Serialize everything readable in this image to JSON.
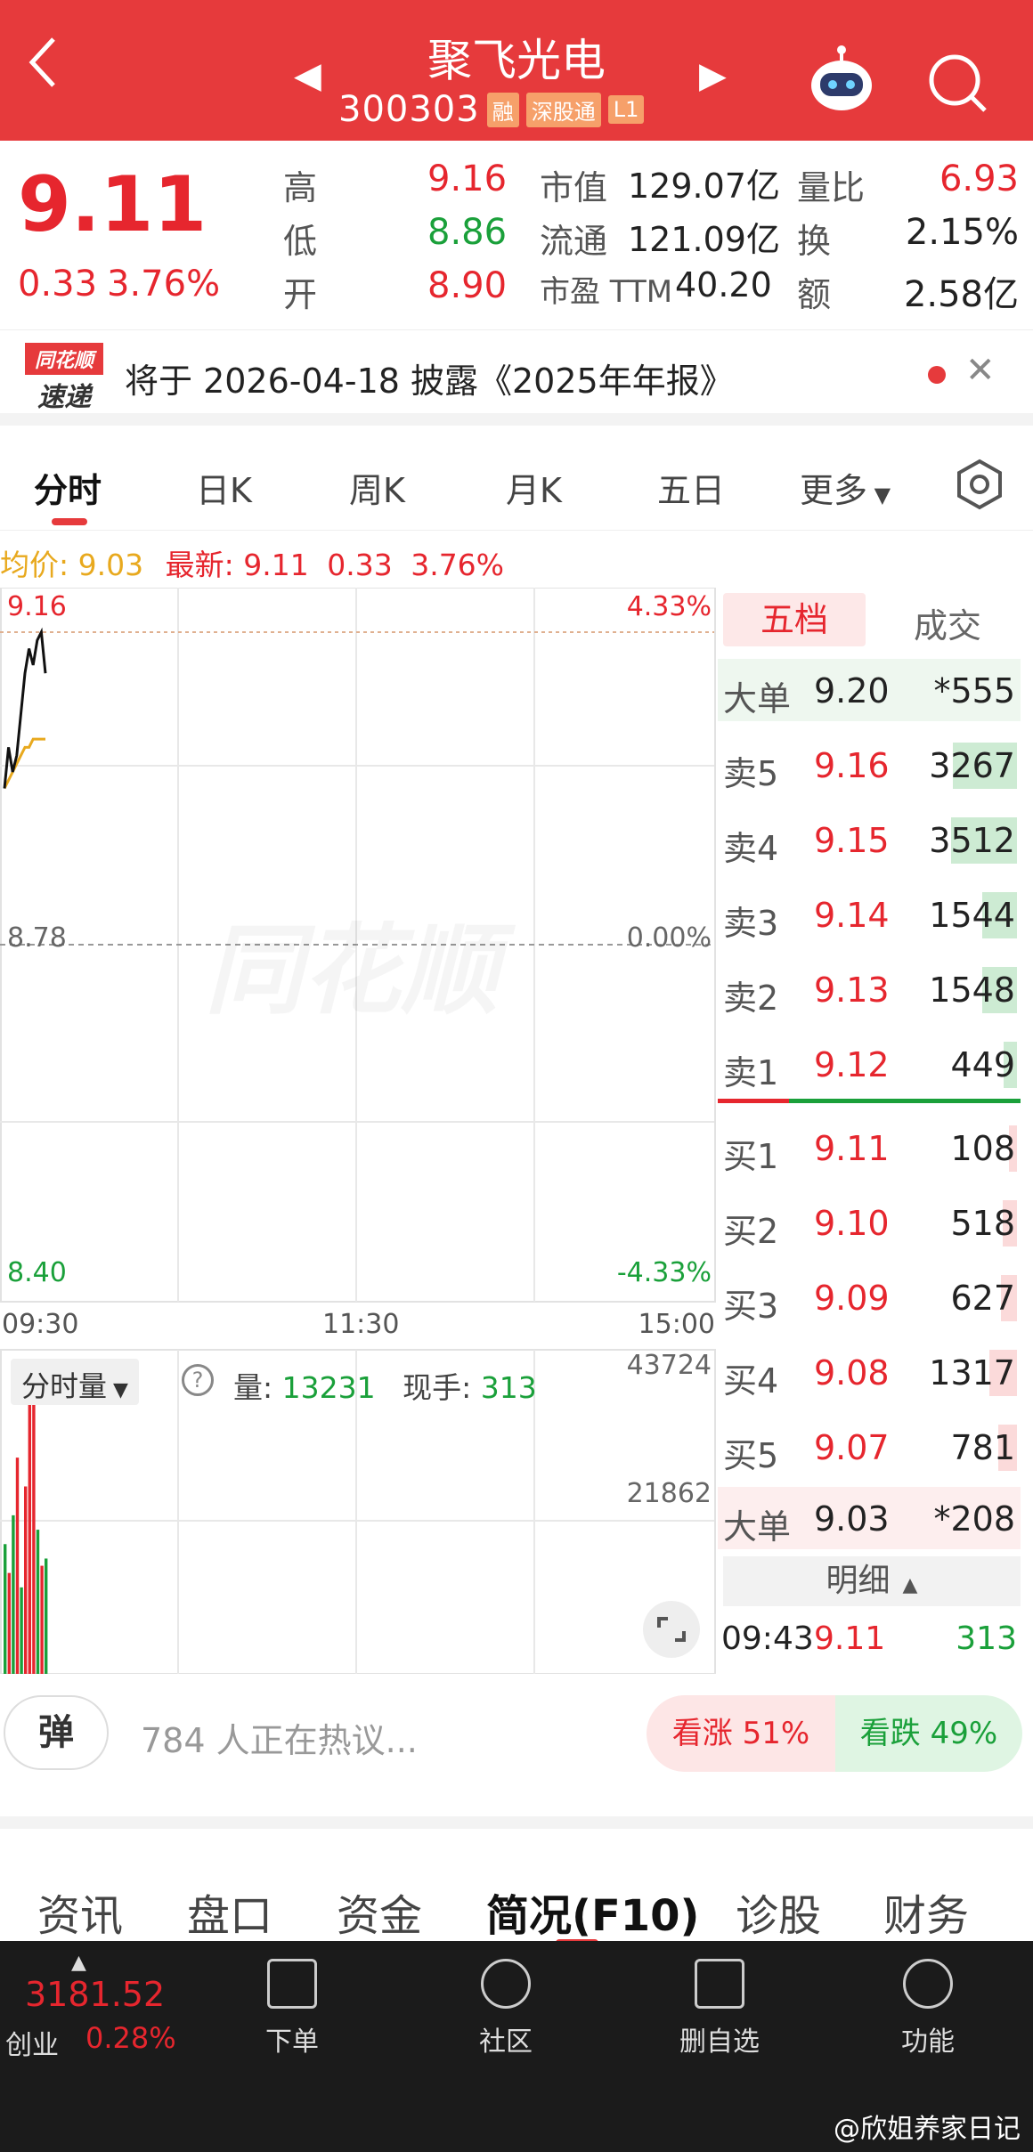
{
  "header": {
    "title": "聚飞光电",
    "code": "300303",
    "tags": [
      "融",
      "深股通",
      "L1"
    ]
  },
  "quote": {
    "price": "9.11",
    "change": "0.33",
    "change_pct": "3.76%",
    "labels": {
      "high": "高",
      "low": "低",
      "open": "开",
      "mcap": "市值",
      "float": "流通",
      "pe": "市盈 TTM",
      "vol_ratio": "量比",
      "turnover": "换",
      "amount": "额"
    },
    "high": "9.16",
    "low": "8.86",
    "open": "8.90",
    "mcap": "129.07亿",
    "float": "121.09亿",
    "pe": "40.20",
    "vol_ratio": "6.93",
    "turnover": "2.15%",
    "amount": "2.58亿"
  },
  "notice": {
    "logo_top": "同花顺",
    "logo_bottom": "速递",
    "text": "将于 2026-04-18 披露《2025年年报》"
  },
  "chart_tabs": [
    "分时",
    "日K",
    "周K",
    "月K",
    "五日",
    "更多"
  ],
  "chart_info": {
    "avg_label": "均价:",
    "avg_value": "9.03",
    "last_label": "最新:",
    "last_value": "9.11",
    "last_change": "0.33",
    "last_pct": "3.76%"
  },
  "chart_data": {
    "type": "line",
    "title": "",
    "x_ticks": [
      "09:30",
      "11:30",
      "15:00"
    ],
    "y_left_ticks": [
      "9.16",
      "8.78",
      "8.40"
    ],
    "y_right_ticks": [
      "4.33%",
      "0.00%",
      "-4.33%"
    ],
    "ylim": [
      8.4,
      9.16
    ],
    "prev_close": 8.78,
    "series": [
      {
        "values": [
          8.97,
          9.02,
          8.99,
          9.01,
          9.06,
          9.11,
          9.14,
          9.12,
          9.15,
          9.16,
          9.11
        ]
      },
      {
        "values": [
          8.97,
          8.98,
          8.99,
          9.0,
          9.01,
          9.02,
          9.02,
          9.03,
          9.03,
          9.03,
          9.03
        ]
      }
    ],
    "colors": {
      "price": "#111111",
      "avg": "#e8a91e",
      "prev_close": "#999999"
    },
    "volume": {
      "label": "分时量",
      "vol_label": "量:",
      "vol_value": "13231",
      "hand_label": "现手:",
      "hand_value": "313",
      "y_ticks": [
        "43724",
        "21862"
      ],
      "ylim": [
        0,
        43724
      ],
      "values": [
        18000,
        14000,
        22000,
        30000,
        12000,
        26000,
        38000,
        43724,
        20000,
        15000,
        16000
      ],
      "directions": [
        "g",
        "r",
        "g",
        "r",
        "g",
        "r",
        "r",
        "r",
        "g",
        "r",
        "g"
      ]
    },
    "watermark": "同花顺"
  },
  "book": {
    "tabs": [
      "五档",
      "成交"
    ],
    "big_sell": {
      "label": "大单",
      "price": "9.20",
      "vol": "*555"
    },
    "asks": [
      {
        "label": "卖5",
        "price": "9.16",
        "vol": "3267",
        "fill": 0.6
      },
      {
        "label": "卖4",
        "price": "9.15",
        "vol": "3512",
        "fill": 0.62
      },
      {
        "label": "卖3",
        "price": "9.14",
        "vol": "1544",
        "fill": 0.3
      },
      {
        "label": "卖2",
        "price": "9.13",
        "vol": "1548",
        "fill": 0.3
      },
      {
        "label": "卖1",
        "price": "9.12",
        "vol": "449",
        "fill": 0.08
      }
    ],
    "bids": [
      {
        "label": "买1",
        "price": "9.11",
        "vol": "108",
        "fill": 0.03
      },
      {
        "label": "买2",
        "price": "9.10",
        "vol": "518",
        "fill": 0.09
      },
      {
        "label": "买3",
        "price": "9.09",
        "vol": "627",
        "fill": 0.11
      },
      {
        "label": "买4",
        "price": "9.08",
        "vol": "1317",
        "fill": 0.23
      },
      {
        "label": "买5",
        "price": "9.07",
        "vol": "781",
        "fill": 0.14
      }
    ],
    "big_buy": {
      "label": "大单",
      "price": "9.03",
      "vol": "*208"
    },
    "detail_label": "明细",
    "detail": {
      "time": "09:43",
      "price": "9.11",
      "vol": "313"
    }
  },
  "discuss": {
    "danmu_label": "弹",
    "text": "784 人正在热议...",
    "up_label": "看涨 51%",
    "down_label": "看跌 49%"
  },
  "bottom_tabs": [
    "资讯",
    "盘口",
    "资金",
    "简况(F10)",
    "诊股",
    "财务"
  ],
  "footer": {
    "index_value": "3181.52",
    "index_name": "创业",
    "index_pct": "0.28%",
    "items": [
      "下单",
      "社区",
      "删自选",
      "功能"
    ],
    "watermark": "@欣姐养家日记"
  }
}
